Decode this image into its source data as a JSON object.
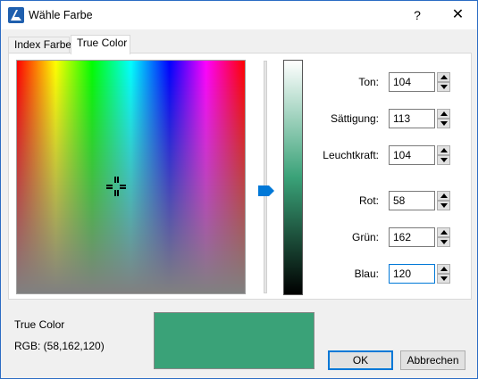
{
  "window": {
    "title": "Wähle Farbe",
    "help_symbol": "?",
    "close_symbol": "✕"
  },
  "tabs": [
    {
      "label": "Index Farbe",
      "active": false
    },
    {
      "label": "True Color",
      "active": true
    }
  ],
  "fields": {
    "ton": {
      "label": "Ton:",
      "value": "104"
    },
    "saettigung": {
      "label": "Sättigung:",
      "value": "113"
    },
    "leuchtkraft": {
      "label": "Leuchtkraft:",
      "value": "104"
    },
    "rot": {
      "label": "Rot:",
      "value": "58"
    },
    "gruen": {
      "label": "Grün:",
      "value": "162"
    },
    "blau": {
      "label": "Blau:",
      "value": "120"
    }
  },
  "footer": {
    "mode_label": "True Color",
    "rgb_label": "RGB: (58,162,120)",
    "preview_color": "#3aa278"
  },
  "buttons": {
    "ok": "OK",
    "cancel": "Abbrechen"
  },
  "colors": {
    "accent": "#0078d7",
    "selected": "#3aa278"
  },
  "icons": {
    "app": "autocad-logo-icon",
    "crosshair": "crosshair-icon",
    "slider": "slider-arrow-icon"
  }
}
